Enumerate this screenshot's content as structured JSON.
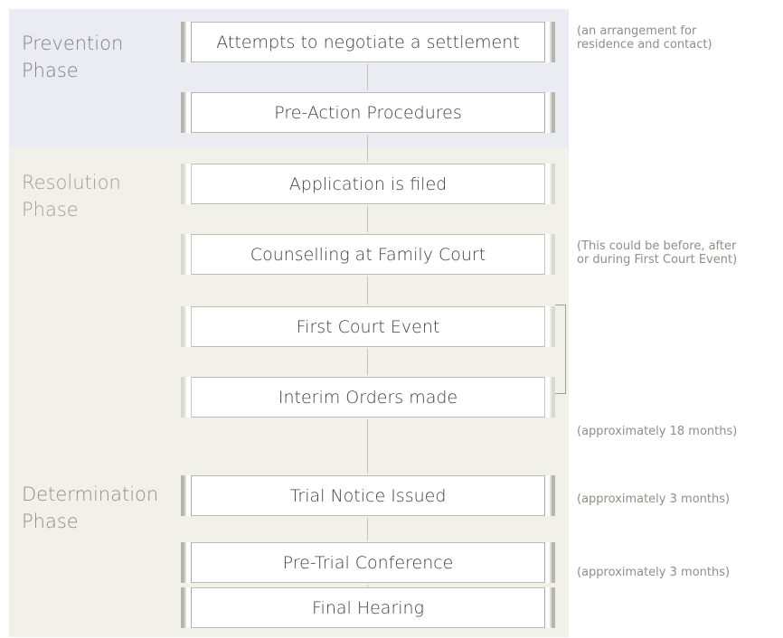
{
  "colors": {
    "prevention_band": "#ebecf2",
    "resolution_band": "#f1f1ea",
    "determination_band": "#f1f1ea",
    "prevention_label": "#7c7f8e",
    "resolution_label": "#9f9f91",
    "determination_label": "#8e8e84"
  },
  "phases": {
    "prevention": "Prevention\nPhase",
    "resolution": "Resolution\nPhase",
    "determination": "Determination\nPhase"
  },
  "steps": [
    {
      "label": "Attempts to negotiate a settlement",
      "style": "dark"
    },
    {
      "label": "Pre-Action Procedures",
      "style": "dark"
    },
    {
      "label": "Application is filed",
      "style": "light"
    },
    {
      "label": "Counselling at Family Court",
      "style": "light"
    },
    {
      "label": "First Court Event",
      "style": "light"
    },
    {
      "label": "Interim Orders made",
      "style": "light"
    },
    {
      "label": "Trial Notice Issued",
      "style": "dark"
    },
    {
      "label": "Pre-Trial Conference",
      "style": "dark"
    },
    {
      "label": "Final Hearing",
      "style": "dark"
    }
  ],
  "notes": {
    "arrangement": "(an arrangement for\nresidence and contact)",
    "counselling_timing": "(This could be before, after\nor during First Court Event)",
    "trial_notice_wait": "(approximately 18 months)",
    "pretrial_wait": "(approximately 3 months)",
    "final_hearing_wait": "(approximately 3 months)"
  }
}
